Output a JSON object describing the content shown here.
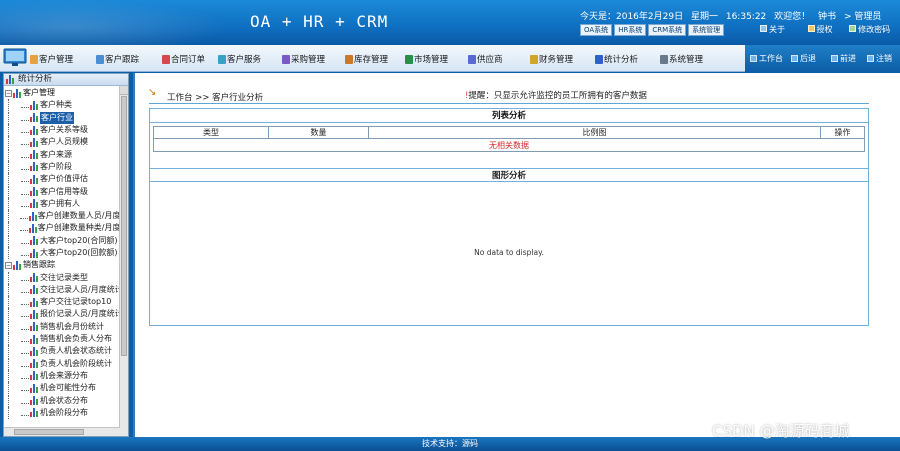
{
  "header": {
    "app_title": "OA + HR + CRM",
    "date_label": "今天是：2016年2月29日",
    "weekday": "星期一",
    "time": "16:35:22",
    "welcome": "欢迎您！",
    "user": "钟书",
    "role": "> 管理员",
    "systems": [
      "OA系统",
      "HR系统",
      "CRM系统",
      "系统管理"
    ],
    "top_actions": {
      "about": "关于",
      "help": "授权",
      "password": "修改密码"
    }
  },
  "nav": {
    "items": [
      "客户管理",
      "客户跟踪",
      "合同订单",
      "客户服务",
      "采购管理",
      "库存管理",
      "市场管理",
      "供应商",
      "财务管理",
      "统计分析",
      "系统管理"
    ],
    "right": {
      "workbench": "工作台",
      "back": "后退",
      "forward": "前进",
      "logout": "注销"
    }
  },
  "sidebar": {
    "title": "统计分析",
    "groups": [
      {
        "label": "客户管理",
        "items": [
          "客户种类",
          "客户行业",
          "客户关系等级",
          "客户人员规模",
          "客户来源",
          "客户阶段",
          "客户价值评估",
          "客户信用等级",
          "客户拥有人",
          "客户创建数量人员/月度统计",
          "客户创建数量种类/月度统计",
          "大客户top20(合同额)",
          "大客户top20(回款额)"
        ]
      },
      {
        "label": "销售跟踪",
        "items": [
          "交往记录类型",
          "交往记录人员/月度统计",
          "客户交往记录top10",
          "报价记录人员/月度统计",
          "销售机会月份统计",
          "销售机会负责人分布",
          "负责人机会状态统计",
          "负责人机会阶段统计",
          "机会来源分布",
          "机会可能性分布",
          "机会状态分布",
          "机会阶段分布"
        ]
      }
    ]
  },
  "main": {
    "breadcrumb": "工作台 >> 客户行业分析",
    "hint": "提醒：只显示允许监控的员工所拥有的客户数据",
    "list_title": "列表分析",
    "columns": [
      "类型",
      "数量",
      "比例图",
      "操作"
    ],
    "empty_text": "无相关数据",
    "graph_title": "图形分析",
    "no_data": "No data to display."
  },
  "footer": {
    "support": "技术支持：源码"
  },
  "watermark": "CSDN @淘源码商城",
  "colors": {
    "header_blue": "#0f6fc0",
    "selected_bg": "#1d5ea6",
    "empty_red": "#d42a2a",
    "border_blue": "#6fb0dd"
  }
}
